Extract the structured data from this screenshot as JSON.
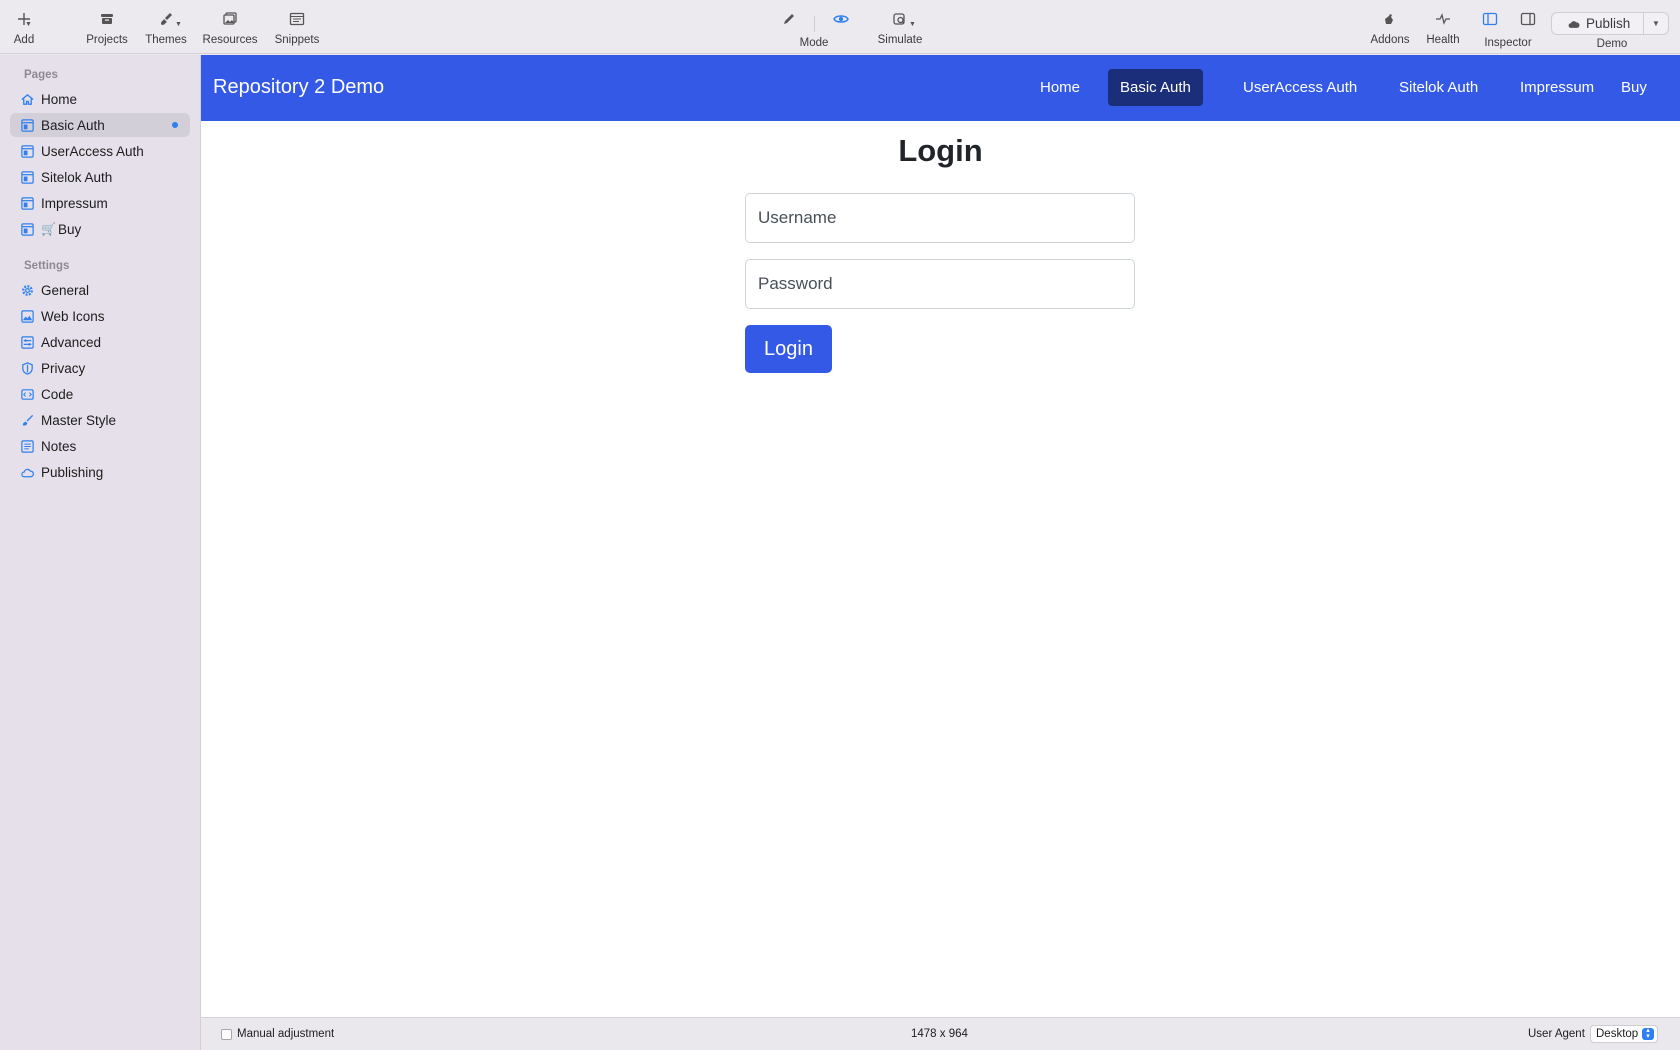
{
  "toolbar": {
    "add": "Add",
    "projects": "Projects",
    "themes": "Themes",
    "resources": "Resources",
    "snippets": "Snippets",
    "mode": "Mode",
    "simulate": "Simulate",
    "addons": "Addons",
    "health": "Health",
    "inspector": "Inspector",
    "publish": "Publish",
    "publish_target": "Demo",
    "accent_color": "#2f7ff0"
  },
  "sidebar": {
    "pages_title": "Pages",
    "pages": [
      {
        "label": "Home",
        "icon": "house-icon"
      },
      {
        "label": "Basic Auth",
        "icon": "page-icon",
        "active": true,
        "modified": true
      },
      {
        "label": "UserAccess Auth",
        "icon": "page-icon"
      },
      {
        "label": "Sitelok Auth",
        "icon": "page-icon"
      },
      {
        "label": "Impressum",
        "icon": "page-icon"
      },
      {
        "label": "Buy",
        "icon": "page-icon",
        "prefix_icon": "cart-icon"
      }
    ],
    "settings_title": "Settings",
    "settings": [
      {
        "label": "General",
        "icon": "gear-icon"
      },
      {
        "label": "Web Icons",
        "icon": "image-icon"
      },
      {
        "label": "Advanced",
        "icon": "sliders-icon"
      },
      {
        "label": "Privacy",
        "icon": "shield-icon"
      },
      {
        "label": "Code",
        "icon": "code-icon"
      },
      {
        "label": "Master Style",
        "icon": "brush-icon"
      },
      {
        "label": "Notes",
        "icon": "notes-icon"
      },
      {
        "label": "Publishing",
        "icon": "cloud-icon"
      }
    ]
  },
  "preview": {
    "brand": "Repository 2 Demo",
    "brand_color": "#3459e6",
    "nav": [
      {
        "label": "Home"
      },
      {
        "label": "Basic Auth",
        "active": true
      },
      {
        "label": "UserAccess Auth"
      },
      {
        "label": "Sitelok Auth"
      },
      {
        "label": "Impressum"
      },
      {
        "label": "Buy"
      }
    ],
    "title": "Login",
    "username_placeholder": "Username",
    "password_placeholder": "Password",
    "login_button": "Login"
  },
  "statusbar": {
    "manual_adjustment": "Manual adjustment",
    "dimensions": "1478 x 964",
    "user_agent_label": "User Agent",
    "user_agent_value": "Desktop"
  }
}
